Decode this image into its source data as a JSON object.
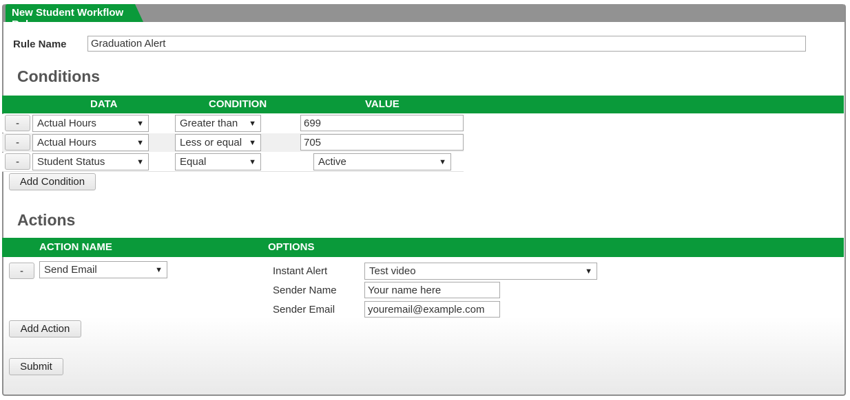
{
  "window": {
    "title": "New Student Workflow Rule"
  },
  "rule": {
    "label": "Rule Name",
    "value": "Graduation Alert"
  },
  "conditions": {
    "heading": "Conditions",
    "headers": {
      "data": "DATA",
      "condition": "CONDITION",
      "value": "VALUE"
    },
    "rows": [
      {
        "remove": "-",
        "data": "Actual Hours",
        "condition": "Greater than",
        "value": "699"
      },
      {
        "remove": "-",
        "data": "Actual Hours",
        "condition": "Less or equal",
        "value": "705"
      },
      {
        "remove": "-",
        "data": "Student Status",
        "condition": "Equal",
        "value": "Active"
      }
    ],
    "add_button": "Add Condition"
  },
  "actions": {
    "heading": "Actions",
    "headers": {
      "action_name": "ACTION NAME",
      "options": "OPTIONS"
    },
    "row": {
      "remove": "-",
      "action": "Send Email",
      "options": {
        "instant_alert": {
          "label": "Instant Alert",
          "value": "Test video"
        },
        "sender_name": {
          "label": "Sender Name",
          "value": "Your name here"
        },
        "sender_email": {
          "label": "Sender Email",
          "value": "youremail@example.com"
        }
      }
    },
    "add_button": "Add Action"
  },
  "submit_label": "Submit",
  "colors": {
    "accent": "#0a9a3a",
    "title_bar": "#929292",
    "row_alt": "#f0f0f0"
  },
  "icons": {
    "dropdown": "triangle-down-icon"
  }
}
